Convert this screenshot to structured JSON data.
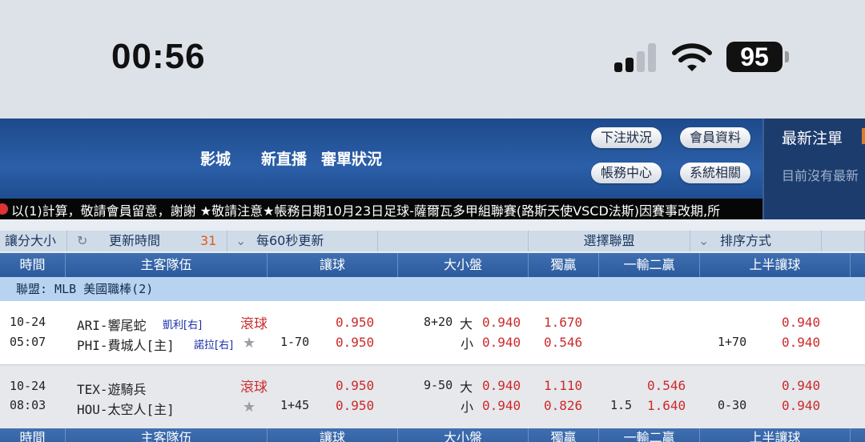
{
  "status_bar": {
    "time": "00:56",
    "battery": "95"
  },
  "header": {
    "nav": [
      "影城",
      "新直播",
      "審單狀況"
    ],
    "buttons": [
      "下注狀況",
      "會員資料",
      "帳務中心",
      "系統相關"
    ]
  },
  "side_panel": {
    "title": "最新注單",
    "subtitle": "目前沒有最新"
  },
  "marquee": "以(1)計算，敬請會員留意，謝謝 ★敬請注意★帳務日期10月23日足球-薩爾瓦多甲組聯賽(路斯天使VSCD法斯)因賽事改期,所",
  "toolbar": {
    "mode": "讓分大小",
    "update_label": "更新時間",
    "countdown": "31",
    "interval": "每60秒更新",
    "select_league": "選擇聯盟",
    "sort": "排序方式"
  },
  "columns": [
    "時間",
    "主客隊伍",
    "讓球",
    "大小盤",
    "獨贏",
    "一輸二贏",
    "上半讓球"
  ],
  "league": "聯盟: MLB 美國職棒(2)",
  "games": [
    {
      "date": "10-24",
      "time": "05:07",
      "away": "ARI-響尾蛇",
      "away_pitcher": "凱利[右]",
      "home": "PHI-費城人[主]",
      "home_pitcher": "諾拉[右]",
      "live": "滾球",
      "handicap": "1-70",
      "hcp_away": "0.950",
      "hcp_home": "0.950",
      "ou_line": "8+20",
      "ou_over_label": "大",
      "ou_over": "0.940",
      "ou_under_label": "小",
      "ou_under": "0.940",
      "ml_away": "1.670",
      "ml_home": "0.546",
      "ol_line": "",
      "ol_away": "",
      "ol_home": "",
      "h1_line": "1+70",
      "h1_away": "0.940",
      "h1_home": "0.940"
    },
    {
      "date": "10-24",
      "time": "08:03",
      "away": "TEX-遊騎兵",
      "away_pitcher": "",
      "home": "HOU-太空人[主]",
      "home_pitcher": "",
      "live": "滾球",
      "handicap": "1+45",
      "hcp_away": "0.950",
      "hcp_home": "0.950",
      "ou_line": "9-50",
      "ou_over_label": "大",
      "ou_over": "0.940",
      "ou_under_label": "小",
      "ou_under": "0.940",
      "ml_away": "1.110",
      "ml_home": "0.826",
      "ol_line": "1.5",
      "ol_away": "0.546",
      "ol_home": "1.640",
      "h1_line": "0-30",
      "h1_away": "0.940",
      "h1_home": "0.940"
    }
  ],
  "colors": {
    "header": "#2b5fa8",
    "league_bar": "#b8d3f0",
    "odds": "#cc2a2a"
  }
}
